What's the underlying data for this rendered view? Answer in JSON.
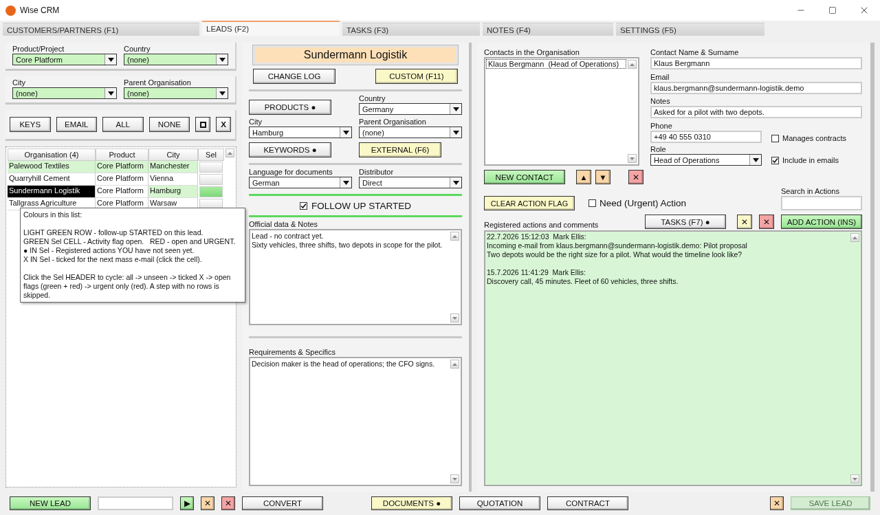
{
  "window": {
    "title": "Wise CRM"
  },
  "tabs": [
    {
      "label": "CUSTOMERS/PARTNERS (F1)",
      "selected": false
    },
    {
      "label": "LEADS (F2)",
      "selected": true
    },
    {
      "label": "TASKS (F3)",
      "selected": false
    },
    {
      "label": "NOTES (F4)",
      "selected": false
    },
    {
      "label": "SETTINGS (F5)",
      "selected": false
    }
  ],
  "filters": [
    [
      {
        "label": "Product/Project",
        "value": "Core Platform"
      },
      {
        "label": "Country",
        "value": "(none)"
      }
    ],
    [
      {
        "label": "City",
        "value": "(none)"
      },
      {
        "label": "Parent Organisation",
        "value": "(none)"
      }
    ]
  ],
  "filter_buttons": [
    {
      "kind": "text",
      "label": "KEYS"
    },
    {
      "kind": "text",
      "label": "EMAIL"
    },
    {
      "kind": "text",
      "label": "ALL"
    },
    {
      "kind": "text",
      "label": "NONE"
    },
    {
      "kind": "square"
    },
    {
      "kind": "text",
      "label": "X"
    }
  ],
  "leads_table": {
    "columns": [
      "Organisation (4)",
      "Product",
      "City",
      "Sel"
    ],
    "rows": [
      {
        "organisation": "Palewood Textiles",
        "product": "Core Platform",
        "city": "Manchester",
        "started": true,
        "selected": false,
        "flag_open": false
      },
      {
        "organisation": "Quarryhill Cement",
        "product": "Core Platform",
        "city": "Vienna",
        "started": false,
        "selected": false,
        "flag_open": false
      },
      {
        "organisation": "Sundermann Logistik",
        "product": "Core Platform",
        "city": "Hamburg",
        "started": true,
        "selected": true,
        "flag_open": true
      },
      {
        "organisation": "Tallgrass Agriculture",
        "product": "Core Platform",
        "city": "Warsaw",
        "started": false,
        "selected": false,
        "flag_open": false
      }
    ]
  },
  "tooltip": {
    "title": "Colours in this list:",
    "lines": [
      "LIGHT GREEN ROW - follow-up STARTED on this lead.",
      "GREEN Sel CELL - Activity flag open.   RED - open and URGENT.",
      "● IN Sel - Registered actions YOU have not seen yet.",
      "X IN Sel - ticked for the next mass e-mail (click the cell)."
    ],
    "footer": "Click the Sel HEADER to cycle: all -> unseen -> ticked X -> open flags (green + red) -> urgent only (red). A step with no rows is skipped."
  },
  "organisation": {
    "name": "Sundermann Logistik",
    "top_buttons": [
      {
        "label": "CHANGE LOG",
        "kind": "plain"
      },
      {
        "label": "CUSTOM (F11)",
        "kind": "yellow"
      }
    ],
    "products_button": {
      "label": "PRODUCTS ●",
      "kind": "plain"
    },
    "country": {
      "label": "Country",
      "value": "Germany"
    },
    "city": {
      "label": "City",
      "value": "Hamburg"
    },
    "parent": {
      "label": "Parent Organisation",
      "value": "(none)"
    },
    "keywords_button": {
      "label": "KEYWORDS ●",
      "kind": "plain"
    },
    "external_button": {
      "label": "EXTERNAL (F6)",
      "kind": "yellow"
    },
    "language": {
      "label": "Language for documents",
      "value": "German"
    },
    "distributor": {
      "label": "Distributor",
      "value": "Direct"
    },
    "follow_up": {
      "label": "FOLLOW UP STARTED",
      "checked": true
    },
    "notes": {
      "label": "Official data & Notes",
      "text": "Lead - no contract yet.\nSixty vehicles, three shifts, two depots in scope for the pilot."
    },
    "requirements": {
      "label": "Requirements & Specifics",
      "text": "Decision maker is the head of operations; the CFO signs."
    }
  },
  "contacts": {
    "label": "Contacts in the Organisation",
    "items": [
      {
        "label": "Klaus Bergmann  (Head of Operations)",
        "selected": true
      }
    ],
    "name": {
      "label": "Contact Name & Surname",
      "value": "Klaus Bergmann"
    },
    "email": {
      "label": "Email",
      "value": "klaus.bergmann@sundermann-logistik.demo"
    },
    "notes": {
      "label": "Notes",
      "value": "Asked for a pilot with two depots."
    },
    "phone": {
      "label": "Phone",
      "value": "+49 40 555 0310"
    },
    "role": {
      "label": "Role",
      "value": "Head of Operations"
    },
    "manages_contracts": {
      "label": "Manages contracts",
      "checked": false
    },
    "include_in_emails": {
      "label": "Include in emails",
      "checked": true
    },
    "buttons": [
      {
        "label": "NEW CONTACT",
        "kind": "green"
      },
      {
        "label": "▲",
        "kind": "orange"
      },
      {
        "label": "▼",
        "kind": "orange"
      },
      {
        "label": "✕",
        "kind": "red"
      }
    ]
  },
  "actions": {
    "clear_button": {
      "label": "CLEAR ACTION FLAG",
      "kind": "yellow"
    },
    "urgent": {
      "label": "Need (Urgent) Action",
      "checked": false
    },
    "search": {
      "label": "Search in Actions"
    },
    "buttons": [
      {
        "label": "TASKS (F7) ●",
        "kind": "plain"
      },
      {
        "label": "✕",
        "kind": "yellow"
      },
      {
        "label": "✕",
        "kind": "red"
      },
      {
        "label": "ADD ACTION (INS)",
        "kind": "green"
      }
    ],
    "log_label": "Registered actions and comments",
    "entries": [
      {
        "header": "22.7.2026 15:12:03  Mark Ellis:",
        "body": "Incoming e-mail from klaus.bergmann@sundermann-logistik.demo: Pilot proposal\nTwo depots would be the right size for a pilot. What would the timeline look like?"
      },
      {
        "header": "15.7.2026 11:41:29  Mark Ellis:",
        "body": "Discovery call, 45 minutes. Fleet of 60 vehicles, three shifts."
      }
    ]
  },
  "bottom_left": [
    {
      "label": "NEW LEAD",
      "kind": "green"
    },
    {
      "kind": "field"
    },
    {
      "label": "▶",
      "kind": "green"
    },
    {
      "label": "✕",
      "kind": "orange"
    },
    {
      "label": "✕",
      "kind": "red"
    },
    {
      "label": "CONVERT",
      "kind": "plain"
    }
  ],
  "bottom_middle": [
    {
      "label": "DOCUMENTS ●",
      "kind": "yellow"
    },
    {
      "label": "QUOTATION",
      "kind": "plain"
    },
    {
      "label": "CONTRACT",
      "kind": "plain"
    }
  ],
  "bottom_right": [
    {
      "label": "✕",
      "kind": "orange",
      "disabled": false
    },
    {
      "label": "SAVE LEAD",
      "kind": "green",
      "disabled": true
    }
  ]
}
